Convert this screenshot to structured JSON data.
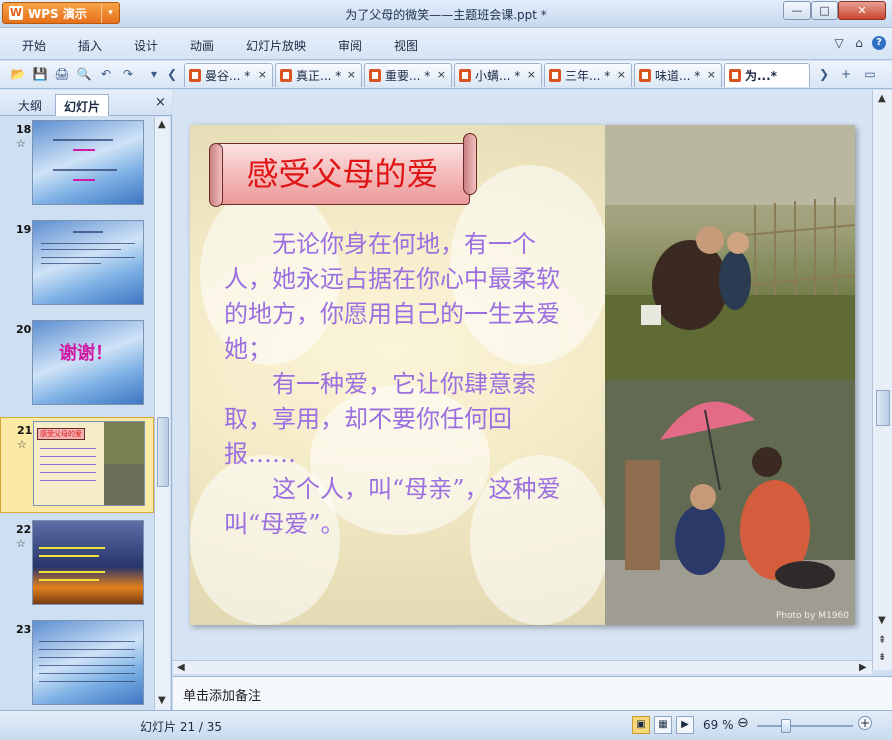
{
  "app": {
    "name": "WPS 演示",
    "logo_letter": "W",
    "drop": "▾",
    "window_title": "为了父母的微笑——主题班会课.ppt *"
  },
  "window_controls": {
    "minimize": "—",
    "maximize": "□",
    "close": "✕"
  },
  "menu": [
    "开始",
    "插入",
    "设计",
    "动画",
    "幻灯片放映",
    "审阅",
    "视图"
  ],
  "menu_right": {
    "user": "▽",
    "mail": "⌂",
    "help": "?"
  },
  "toolbar_icons": [
    "open-icon",
    "save-icon",
    "print-icon",
    "print-preview-icon",
    "undo-icon",
    "redo-icon"
  ],
  "toolbar_glyphs": [
    "📂",
    "💾",
    "🖨",
    "🔍",
    "↶",
    "↷",
    "▾",
    "❮"
  ],
  "tabs": [
    {
      "label": "曼谷... *"
    },
    {
      "label": "真正... *"
    },
    {
      "label": "重要... *"
    },
    {
      "label": "小螨... *"
    },
    {
      "label": "三年... *"
    },
    {
      "label": "味道... *"
    },
    {
      "label": "为...*"
    }
  ],
  "tab_close": "×",
  "tab_nav": {
    "next": "❯",
    "new": "+",
    "list": "▭"
  },
  "left_pane": {
    "tabs": [
      "大纲",
      "幻灯片"
    ],
    "close": "×",
    "slides": [
      {
        "num": "18",
        "star": "☆"
      },
      {
        "num": "19",
        "star": ""
      },
      {
        "num": "20",
        "star": ""
      },
      {
        "num": "21",
        "star": "☆"
      },
      {
        "num": "22",
        "star": "☆"
      },
      {
        "num": "23",
        "star": ""
      }
    ],
    "thumb_texts": {
      "s20": "谢谢！",
      "s21": "感受父母的爱"
    }
  },
  "slide": {
    "title": "感受父母的爱",
    "paragraphs": [
      "无论你身在何地，有一个人，她永远占据在你心中最柔软的地方，你愿用自己的一生去爱她；",
      "有一种爱，它让你肆意索取，享用，却不要你任何回报……",
      "这个人，叫“母亲”，这种爱叫“母爱”。"
    ],
    "photo_credit": "Photo by M1960"
  },
  "notes": {
    "placeholder": "单击添加备注"
  },
  "status": {
    "counter": "幻灯片 21 / 35",
    "zoom": "69 %",
    "zoom_fraction": 0.3,
    "zoom_minus": "⊖",
    "zoom_plus": "+"
  },
  "scroll_arrows": {
    "up": "▲",
    "down": "▼",
    "left": "◀",
    "right": "▶",
    "double_up": "⇞",
    "double_down": "⇟"
  },
  "colors": {
    "title_red": "#e01515",
    "body_purple": "#9b6fe0",
    "accent_orange": "#e6701a"
  }
}
